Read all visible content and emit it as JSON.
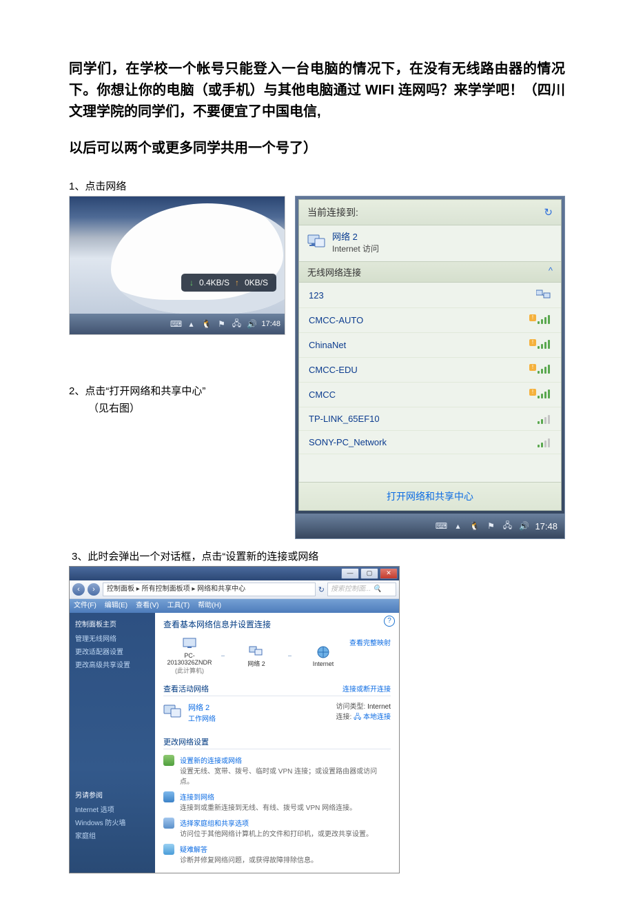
{
  "intro": {
    "p1": "同学们，在学校一个帐号只能登入一台电脑的情况下，在没有无线路由器的情况下。你想让你的电脑（或手机）与其他电脑通过 WIFI 连网吗？来学学吧！（四川文理学院的同学们，不要便宜了中国电信,",
    "p2": "以后可以两个或更多同学共用一个号了）"
  },
  "steps": {
    "s1": "1、点击网络",
    "s2a": "2、点击“打开网络和共享中心”",
    "s2b": "（见右图）",
    "s3": "3、此时会弹出一个对话框，点击“设置新的连接或网络"
  },
  "shot1": {
    "down_arrow": "↓",
    "down_val": "0.4KB/S",
    "up_arrow": "↑",
    "up_val": "0KB/S",
    "time": "17:48"
  },
  "flyout": {
    "header": "当前连接到:",
    "conn_title": "网络  2",
    "conn_sub": "Internet 访问",
    "section": "无线网络连接",
    "items": [
      "123",
      "CMCC-AUTO",
      "ChinaNet",
      "CMCC-EDU",
      "CMCC",
      "TP-LINK_65EF10",
      "SONY-PC_Network"
    ],
    "open_center": "打开网络和共享中心",
    "time": "17:48"
  },
  "nc": {
    "breadcrumb": "控制面板 ▸ 所有控制面板项 ▸ 网络和共享中心",
    "search_ph": "搜索控制面... 🔍",
    "menu": [
      "文件(F)",
      "编辑(E)",
      "查看(V)",
      "工具(T)",
      "帮助(H)"
    ],
    "side": {
      "home": "控制面板主页",
      "l1": "管理无线网络",
      "l2": "更改适配器设置",
      "l3": "更改高级共享设置",
      "also": "另请参阅",
      "a1": "Internet 选项",
      "a2": "Windows 防火墙",
      "a3": "家庭组"
    },
    "main": {
      "title": "查看基本网络信息并设置连接",
      "full_map": "查看完整映射",
      "node1a": "PC-20130326ZNDR",
      "node1b": "(此计算机)",
      "node2": "网络 2",
      "node3": "Internet",
      "conn_or": "连接或断开连接",
      "active_h": "查看活动网络",
      "an_name": "网络 2",
      "an_type": "工作网络",
      "an_r1l": "访问类型:",
      "an_r1v": "Internet",
      "an_r2l": "连接:",
      "an_r2v": "本地连接",
      "change_h": "更改网络设置",
      "t1a": "设置新的连接或网络",
      "t1b": "设置无线、宽带、拨号、临时或 VPN 连接；或设置路由器或访问点。",
      "t2a": "连接到网络",
      "t2b": "连接到或重新连接到无线、有线、拨号或 VPN 网络连接。",
      "t3a": "选择家庭组和共享选项",
      "t3b": "访问位于其他网络计算机上的文件和打印机，或更改共享设置。",
      "t4a": "疑难解答",
      "t4b": "诊断并修复网络问题，或获得故障排除信息。"
    }
  }
}
